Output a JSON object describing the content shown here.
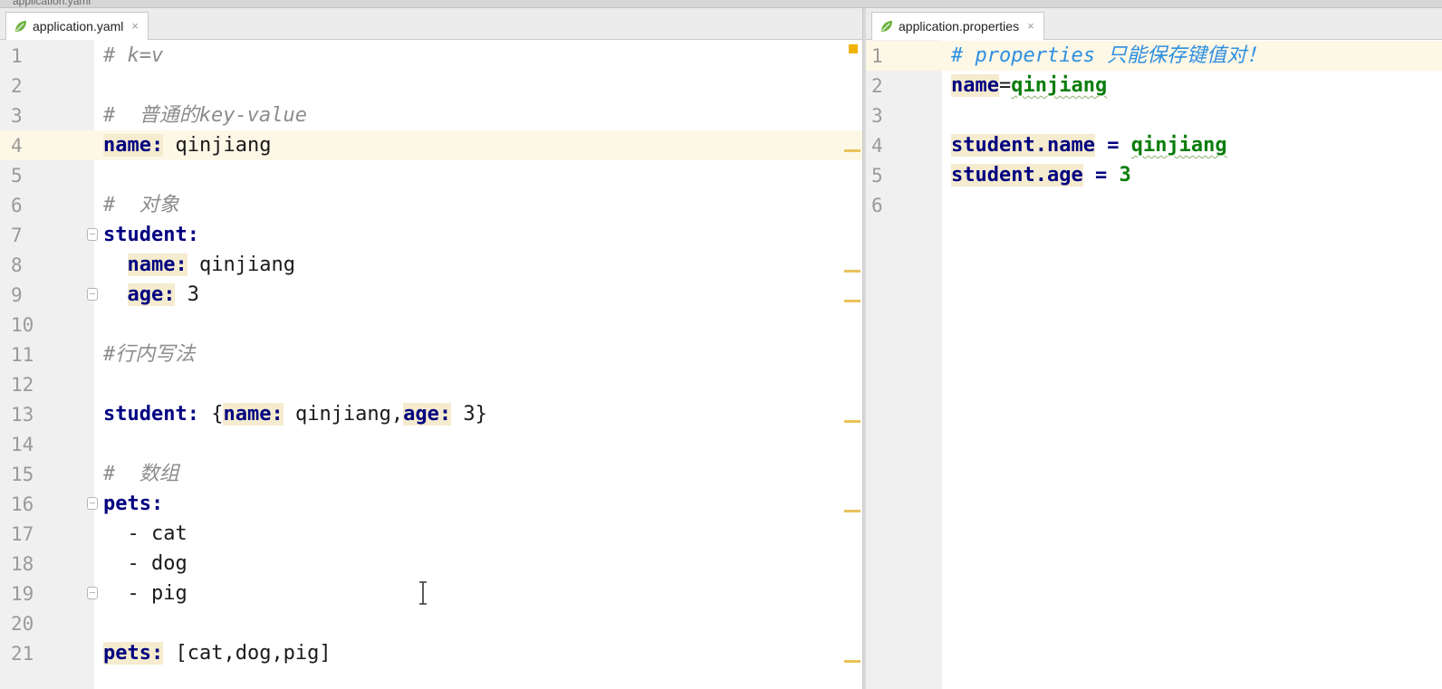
{
  "window": {
    "title_fragment": "application.yaml"
  },
  "left_tab": {
    "label": "application.yaml",
    "close": "×",
    "icon": "spring-leaf-icon"
  },
  "right_tab": {
    "label": "application.properties",
    "close": "×",
    "icon": "spring-leaf-icon"
  },
  "yaml": {
    "line_numbers": [
      "1",
      "2",
      "3",
      "4",
      "5",
      "6",
      "7",
      "8",
      "9",
      "10",
      "11",
      "12",
      "13",
      "14",
      "15",
      "16",
      "17",
      "18",
      "19",
      "20",
      "21"
    ],
    "l1": "# k=v",
    "l3": "#  普通的key-value",
    "l4_key": "name:",
    "l4_val": " qinjiang",
    "l6": "#  对象",
    "l7_key": "student:",
    "l8_indent": "  ",
    "l8_key": "name:",
    "l8_val": " qinjiang",
    "l9_indent": "  ",
    "l9_key": "age:",
    "l9_val": " 3",
    "l11": "#行内写法",
    "l13_key": "student:",
    "l13_open": " {",
    "l13_k1": "name:",
    "l13_v1": " qinjiang,",
    "l13_k2": "age:",
    "l13_v2": " 3}",
    "l15": "#  数组",
    "l16_key": "pets:",
    "l17": "  - cat",
    "l18": "  - dog",
    "l19": "  - pig",
    "l21_key": "pets:",
    "l21_val": " [cat,dog,pig]"
  },
  "properties": {
    "line_numbers": [
      "1",
      "2",
      "3",
      "4",
      "5",
      "6"
    ],
    "l1": "# properties 只能保存键值对！",
    "l2_key": "name",
    "l2_eq": "=",
    "l2_val": "qinjiang",
    "l4_key": "student.name",
    "l4_eq": " = ",
    "l4_val": "qinjiang",
    "l5_key": "student.age",
    "l5_eq": " = ",
    "l5_val": "3"
  },
  "colors": {
    "keyword": "#000080",
    "value": "#0b7d0b",
    "comment": "#8c8c8c",
    "doc_comment": "#2e8fe0",
    "current_line": "#fdf7e6",
    "key_highlight": "#f5ebce"
  }
}
